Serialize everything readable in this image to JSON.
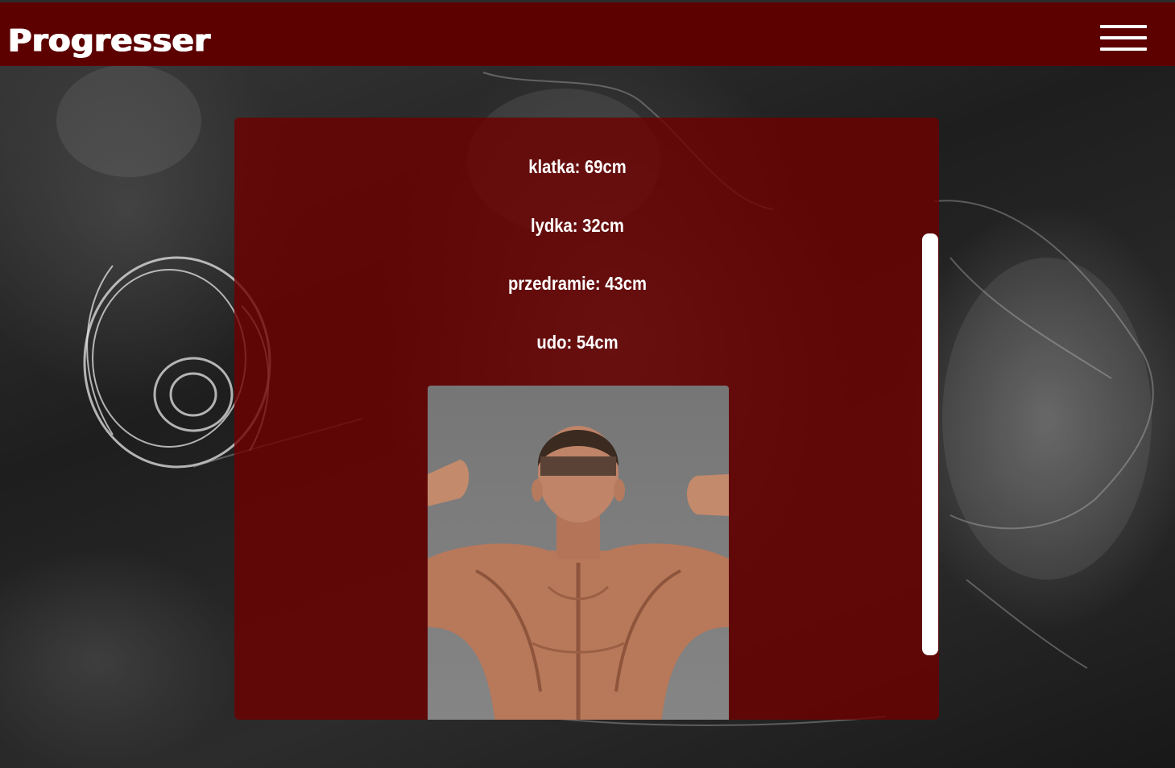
{
  "header": {
    "brand": "Progresser",
    "menu_icon": "hamburger-menu-icon",
    "background_color": "#5c0000"
  },
  "card": {
    "background_color": "#6e0000",
    "measurements": [
      {
        "label": "klatka: 69cm"
      },
      {
        "label": "lydka: 32cm"
      },
      {
        "label": "przedramie: 43cm"
      },
      {
        "label": "udo: 54cm"
      }
    ],
    "photo_description_icon": "back-muscles-photo"
  },
  "scrollbar": {
    "color": "#ffffff"
  }
}
